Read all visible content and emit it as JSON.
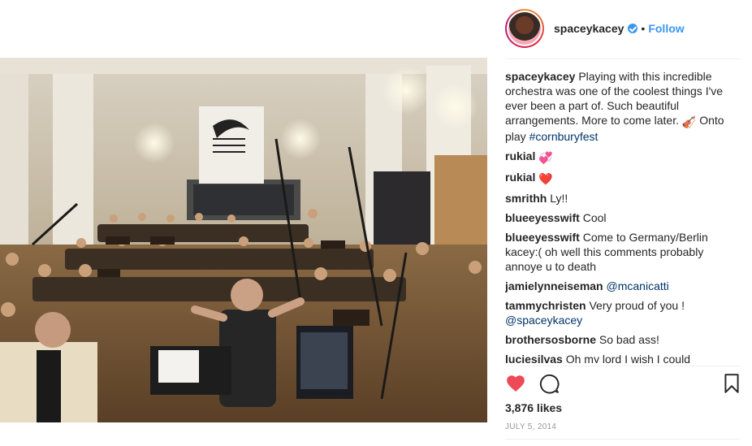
{
  "post": {
    "photo_icon": "orchestra-studio-photo",
    "author": {
      "username": "spaceykacey",
      "verified_icon": "verified-badge-icon",
      "separator": "•",
      "follow_label": "Follow"
    },
    "caption": {
      "user": "spaceykacey",
      "text": "Playing with this incredible orchestra was one of the coolest things I've ever been a part of. Such beautiful arrangements. More to come later.",
      "emoji": "🎻",
      "text_after": "Onto play",
      "hashtag": "#cornburyfest"
    },
    "comments": [
      {
        "user": "rukial",
        "text": "💞"
      },
      {
        "user": "rukial",
        "text": "❤️"
      },
      {
        "user": "smrithh",
        "text": "Ly!!"
      },
      {
        "user": "blueeyesswift",
        "text": "Cool"
      },
      {
        "user": "blueeyesswift",
        "text": "Come to Germany/Berlin kacey:( oh well this comments probably annoye u to death"
      },
      {
        "user": "jamielynneiseman",
        "text": "@mcanicatti"
      },
      {
        "user": "tammychristen",
        "text": "Very proud of you !",
        "mention": "@spaceykacey"
      },
      {
        "user": "brothersosborne",
        "text": "So bad ass!"
      },
      {
        "user": "luciesilvas",
        "text": "Oh my lord I wish I could"
      }
    ],
    "actions": {
      "like_icon": "heart-filled-icon",
      "comment_icon": "comment-bubble-icon",
      "save_icon": "bookmark-icon"
    },
    "likes_label": "3,876 likes",
    "date": "July 5, 2014",
    "colors": {
      "accent": "#3897f0",
      "like_red": "#ed4956",
      "text": "#262626",
      "muted": "#999999"
    }
  }
}
